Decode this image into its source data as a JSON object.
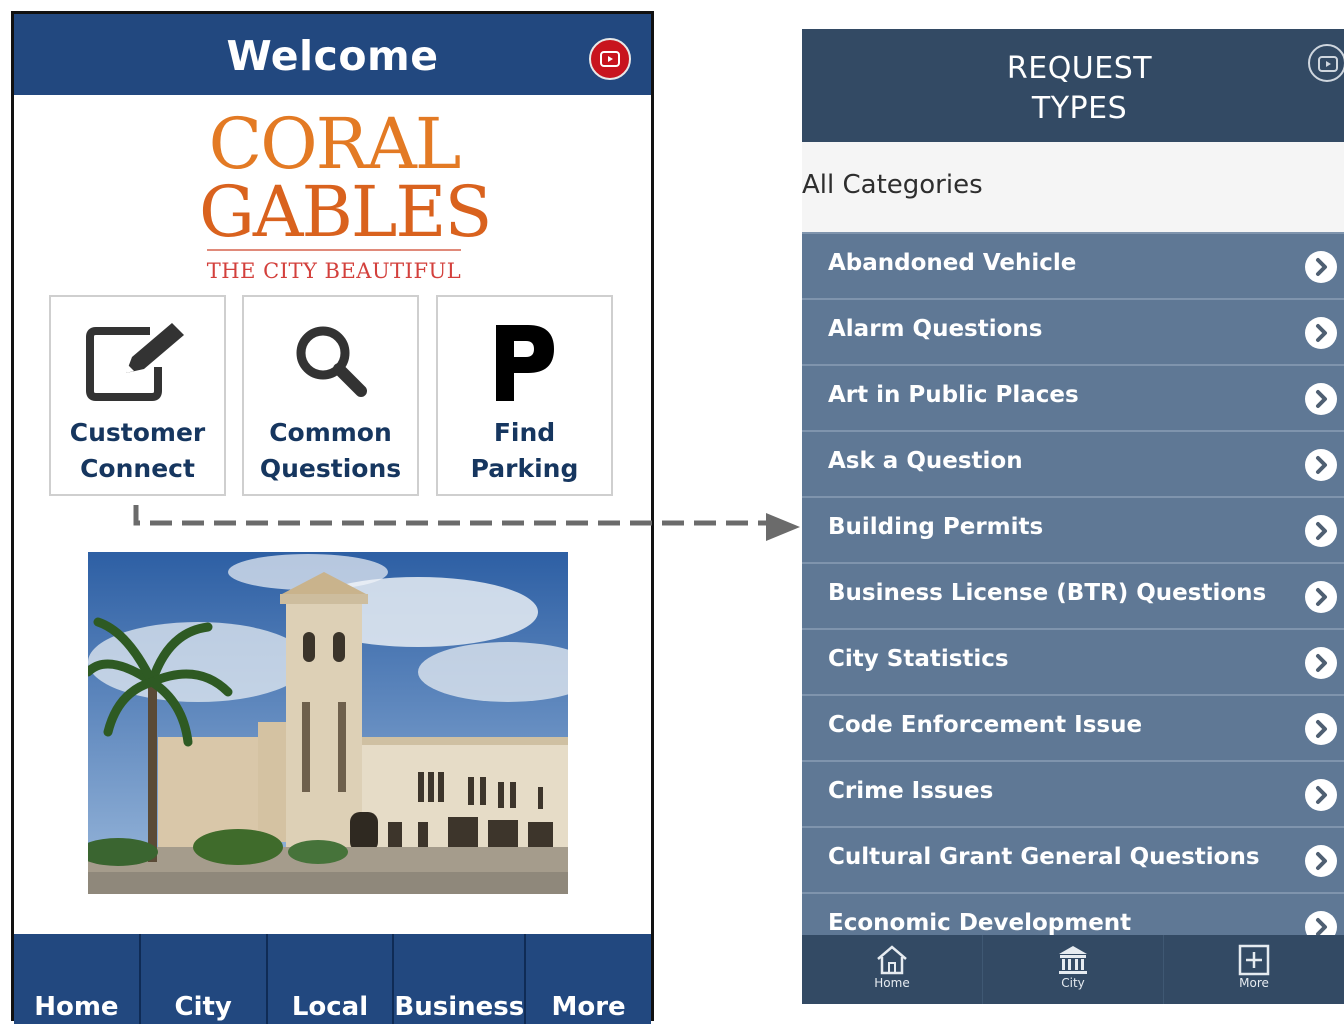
{
  "left_screen": {
    "header": {
      "title": "Welcome",
      "video_icon": "video-play-icon",
      "accent": "#c8141e",
      "bar_color": "#22487f"
    },
    "logo": {
      "line1": "CORAL",
      "line2": "GABLES",
      "tagline": "THE CITY BEAUTIFUL"
    },
    "tiles": [
      {
        "icon": "edit-icon",
        "line1": "Customer",
        "line2": "Connect"
      },
      {
        "icon": "search-icon",
        "line1": "Common",
        "line2": "Questions"
      },
      {
        "icon": "parking-icon",
        "line1": "Find",
        "line2": "Parking"
      }
    ],
    "photo": {
      "icon": "city-hall-photo"
    },
    "tabs": [
      "Home",
      "City",
      "Local",
      "Business",
      "More"
    ]
  },
  "right_screen": {
    "header": {
      "title_line1": "REQUEST",
      "title_line2": "TYPES",
      "video_icon": "video-play-icon",
      "bar_color": "#334a64"
    },
    "category_label": "All Categories",
    "items": [
      "Abandoned Vehicle",
      "Alarm Questions",
      "Art in Public Places",
      "Ask a Question",
      "Building Permits",
      "Business License (BTR) Questions",
      "City Statistics",
      "Code Enforcement Issue",
      "Crime Issues",
      "Cultural Grant General Questions",
      "Economic Development"
    ],
    "tabs": [
      {
        "icon": "home-icon",
        "label": "Home"
      },
      {
        "icon": "city-icon",
        "label": "City"
      },
      {
        "icon": "plus-icon",
        "label": "More"
      }
    ]
  }
}
